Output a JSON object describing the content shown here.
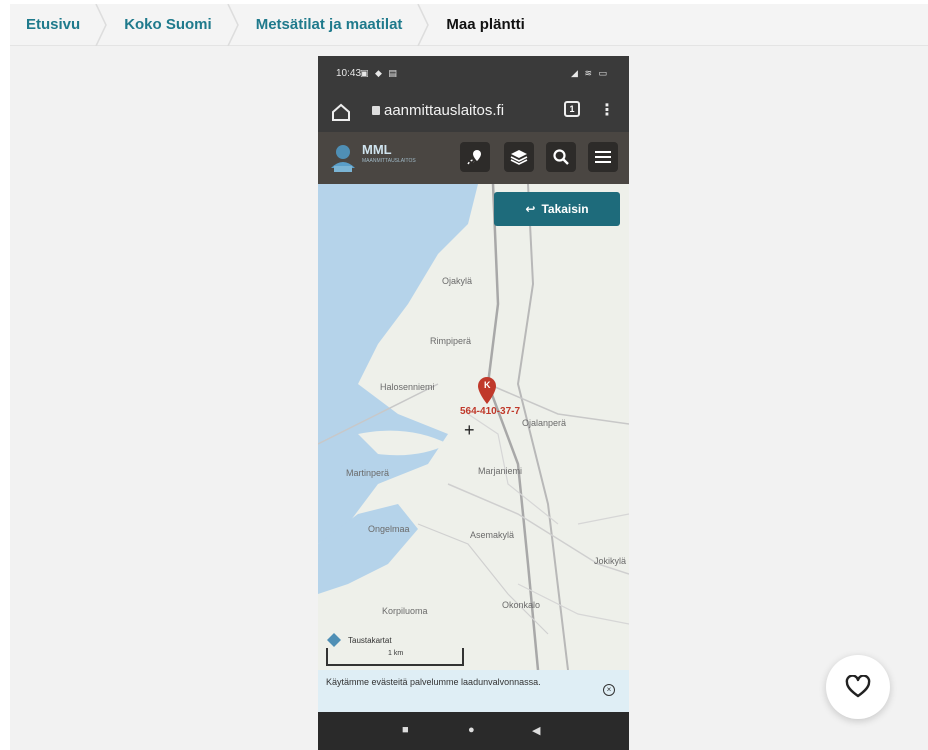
{
  "breadcrumb": {
    "items": [
      {
        "label": "Etusivu"
      },
      {
        "label": "Koko Suomi"
      },
      {
        "label": "Metsätilat ja maatilat"
      },
      {
        "label": "Maa pläntti"
      }
    ]
  },
  "phone": {
    "status_time": "10:43",
    "url": "aanmittauslaitos.fi",
    "tabs_count": "1",
    "logo_text": "MML",
    "logo_sub": "MAANMITTAUSLAITOS",
    "back_button": "Takaisin",
    "map_labels": {
      "ojakyla": "Ojakylä",
      "rimpi": "Rimpiperä",
      "halosenniemi": "Halosenniemi",
      "ojalanpera": "Ojalanperä",
      "marjo": "Marjaniemi",
      "martinperä": "Martinperä",
      "ongelmaa": "Ongelmaa",
      "asemakyla": "Asemakylä",
      "jokikyla": "Jokikylä",
      "korpi": "Korpiluoma",
      "konkalo": "Okonkalo"
    },
    "parcel_id": "564-410-37-7",
    "parcel_marker": "K",
    "scale_label": "1 km",
    "attribution": "Taustakartat",
    "cookie_text": "Käytämme evästeitä palvelumme laadunvalvonnassa.",
    "colors": {
      "accent": "#1e6b7b",
      "marker": "#c0392b",
      "breadcrumb_link": "#1f7a8c"
    }
  },
  "favorite": {
    "icon": "heart-icon"
  }
}
